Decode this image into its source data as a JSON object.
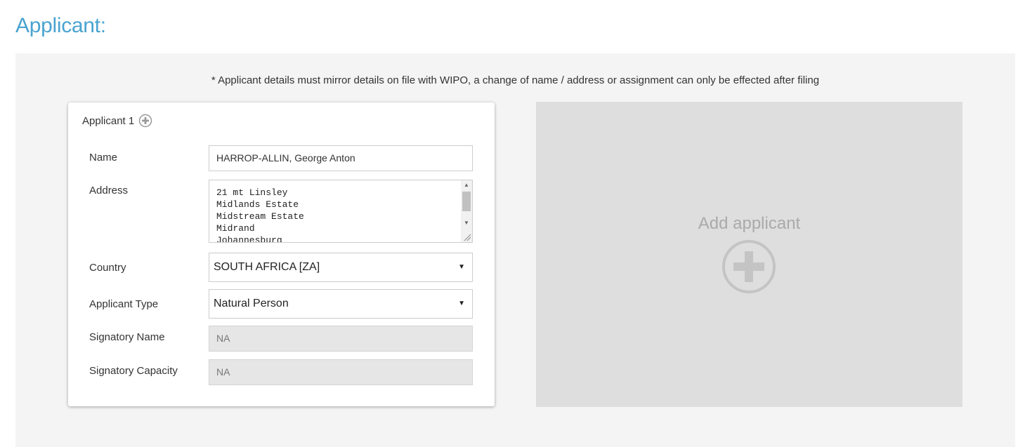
{
  "page": {
    "title": "Applicant:",
    "notice": "* Applicant details must mirror details on file with WIPO, a change of name / address or assignment can only be effected after filing",
    "accent_color": "#4aa3d0"
  },
  "applicant": {
    "header": "Applicant 1",
    "header_icon": "plus-circle-icon",
    "name_label": "Name",
    "name_value": "HARROP-ALLIN, George Anton",
    "address_label": "Address",
    "address_lines": [
      "21 mt Linsley",
      "Midlands Estate",
      "Midstream Estate",
      "Midrand",
      "Johannesburg"
    ],
    "country_label": "Country",
    "country_value": "SOUTH AFRICA [ZA]",
    "type_label": "Applicant Type",
    "type_value": "Natural Person",
    "signatory_name_label": "Signatory Name",
    "signatory_name_value": "NA",
    "signatory_capacity_label": "Signatory Capacity",
    "signatory_capacity_value": "NA"
  },
  "add_applicant": {
    "label": "Add applicant",
    "icon": "plus-circle-icon"
  }
}
